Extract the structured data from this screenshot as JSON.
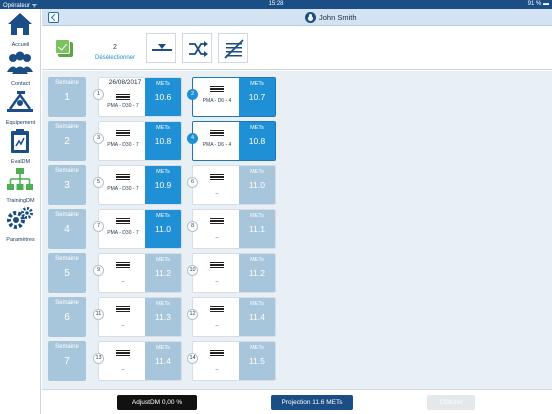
{
  "status": {
    "carrier": "Opérateur ᯤ",
    "time": "15:28",
    "battery": "91 % ▬"
  },
  "sidebar": {
    "items": [
      {
        "label": "Accueil"
      },
      {
        "label": "Contact"
      },
      {
        "label": "Equipement"
      },
      {
        "label": "EvalDM"
      },
      {
        "label": "TrainingDM"
      },
      {
        "label": "Paramètres"
      }
    ]
  },
  "header": {
    "user_name": "John Smith"
  },
  "toolbar": {
    "count": "2",
    "deselect_label": "Désélectionner"
  },
  "colors": {
    "accent": "#1f8fd6",
    "brand": "#1c4e86",
    "muted": "#a7c6dc"
  },
  "grid": {
    "week_label": "Semaine",
    "met_label": "METs",
    "rows": [
      {
        "week": "1",
        "c1": {
          "num": "1",
          "date": "26/08/2017",
          "plabel": "PMA - D30 - 7",
          "met": "10.6",
          "on": true,
          "selected": false,
          "num_on": false
        },
        "c2": {
          "num": "2",
          "date": "",
          "plabel": "PMA - D6 - 4",
          "met": "10.7",
          "on": true,
          "selected": true,
          "num_on": true
        }
      },
      {
        "week": "2",
        "c1": {
          "num": "3",
          "date": "",
          "plabel": "PMA - D30 - 7",
          "met": "10.8",
          "on": true,
          "selected": false,
          "num_on": false
        },
        "c2": {
          "num": "4",
          "date": "",
          "plabel": "PMA - D6 - 4",
          "met": "10.8",
          "on": true,
          "selected": true,
          "num_on": true
        }
      },
      {
        "week": "3",
        "c1": {
          "num": "5",
          "date": "",
          "plabel": "PMA - D30 - 7",
          "met": "10.9",
          "on": true,
          "selected": false,
          "num_on": false
        },
        "c2": {
          "num": "6",
          "date": "",
          "plabel": "--",
          "met": "11.0",
          "on": false,
          "selected": false,
          "num_on": false
        }
      },
      {
        "week": "4",
        "c1": {
          "num": "7",
          "date": "",
          "plabel": "PMA - D30 - 7",
          "met": "11.0",
          "on": true,
          "selected": false,
          "num_on": false
        },
        "c2": {
          "num": "8",
          "date": "",
          "plabel": "--",
          "met": "11.1",
          "on": false,
          "selected": false,
          "num_on": false
        }
      },
      {
        "week": "5",
        "c1": {
          "num": "9",
          "date": "",
          "plabel": "--",
          "met": "11.2",
          "on": false,
          "selected": false,
          "num_on": false
        },
        "c2": {
          "num": "10",
          "date": "",
          "plabel": "--",
          "met": "11.2",
          "on": false,
          "selected": false,
          "num_on": false
        }
      },
      {
        "week": "6",
        "c1": {
          "num": "11",
          "date": "",
          "plabel": "--",
          "met": "11.3",
          "on": false,
          "selected": false,
          "num_on": false
        },
        "c2": {
          "num": "12",
          "date": "",
          "plabel": "--",
          "met": "11.4",
          "on": false,
          "selected": false,
          "num_on": false
        }
      },
      {
        "week": "7",
        "c1": {
          "num": "13",
          "date": "",
          "plabel": "--",
          "met": "11.4",
          "on": false,
          "selected": false,
          "num_on": false
        },
        "c2": {
          "num": "14",
          "date": "",
          "plabel": "--",
          "met": "11.5",
          "on": false,
          "selected": false,
          "num_on": false
        }
      }
    ]
  },
  "footer": {
    "adjust_label": "AdjustDM 0,00 %",
    "projection_label": "Projection 11.6 METs",
    "close_label": "Clôturer"
  }
}
